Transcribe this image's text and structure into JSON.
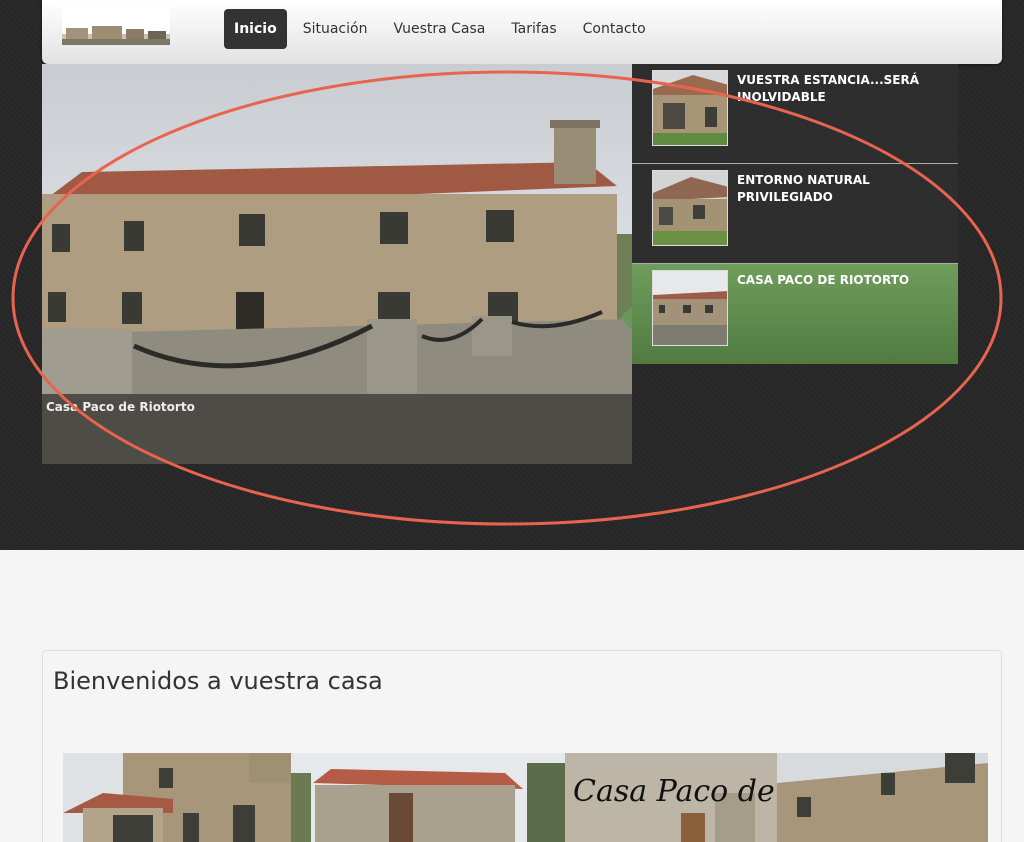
{
  "nav": {
    "items": [
      {
        "label": "Inicio",
        "active": true
      },
      {
        "label": "Situación",
        "active": false
      },
      {
        "label": "Vuestra Casa",
        "active": false
      },
      {
        "label": "Tarifas",
        "active": false
      },
      {
        "label": "Contacto",
        "active": false
      }
    ]
  },
  "slider": {
    "caption": "Casa Paco de Riotorto"
  },
  "thumbs": [
    {
      "title": "VUESTRA ESTANCIA...SERÁ INOLVIDABLE"
    },
    {
      "title": "ENTORNO NATURAL PRIVILEGIADO"
    },
    {
      "title": "CASA PACO DE RIOTORTO"
    }
  ],
  "welcome": {
    "title": "Bienvenidos a vuestra casa"
  },
  "logo_text": "Casa Paco de Riotorto",
  "colors": {
    "accent_green": "#5f8c4f",
    "nav_active": "#333333",
    "annotation": "#e8644f"
  }
}
